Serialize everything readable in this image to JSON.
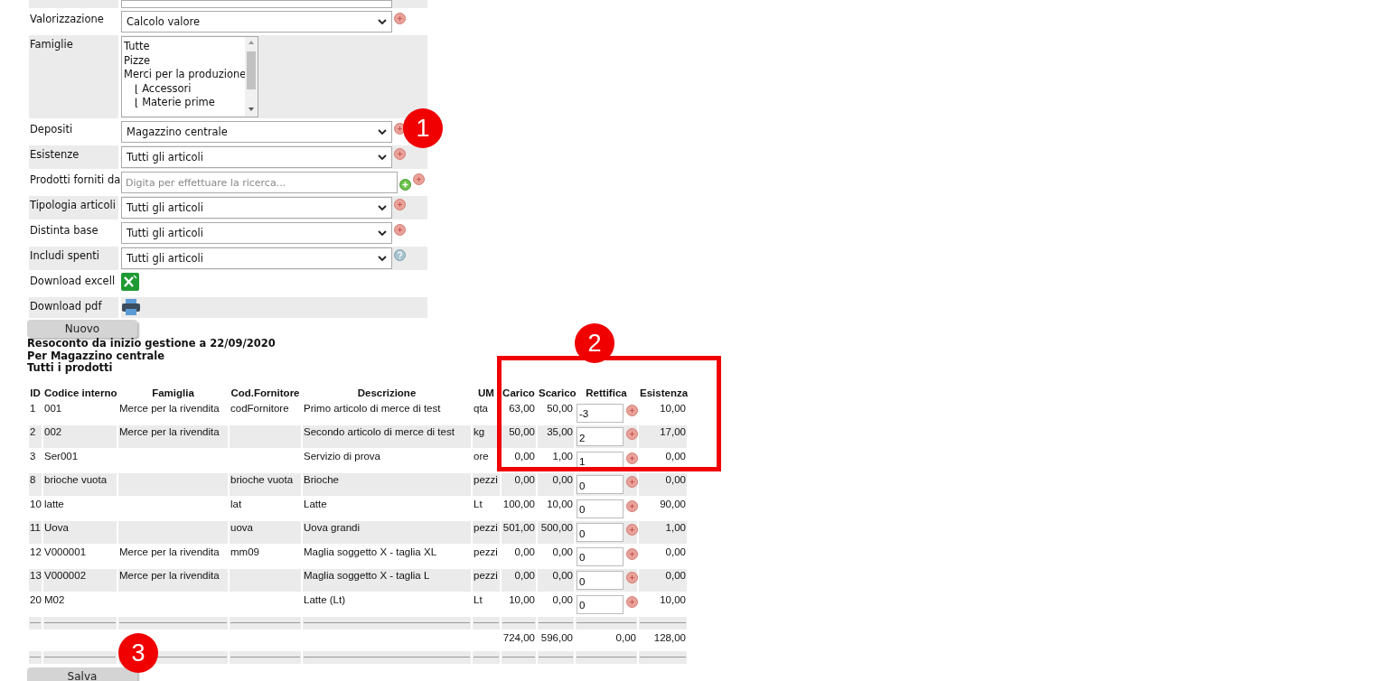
{
  "filters": [
    {
      "kind": "select_cut"
    },
    {
      "kind": "select",
      "label": "Valorizzazione",
      "value": "Calcolo valore"
    },
    {
      "kind": "listbox",
      "label": "Famiglie",
      "items": [
        {
          "text": "Tutte"
        },
        {
          "text": "Pizze"
        },
        {
          "text": "Merci per la produzione",
          "children": [
            {
              "text": "⌊ Accessori"
            },
            {
              "text": "⌊ Materie prime"
            }
          ]
        }
      ]
    },
    {
      "kind": "select",
      "label": "Depositi",
      "value": "Magazzino centrale"
    },
    {
      "kind": "select",
      "label": "Esistenze",
      "value": "Tutti gli articoli"
    },
    {
      "kind": "search",
      "label": "Prodotti forniti da",
      "placeholder": "Digita per effettuare la ricerca..."
    },
    {
      "kind": "select",
      "label": "Tipologia articoli",
      "value": "Tutti gli articoli"
    },
    {
      "kind": "select",
      "label": "Distinta base",
      "value": "Tutti gli articoli"
    },
    {
      "kind": "select_help",
      "label": "Includi spenti",
      "value": "Tutti gli articoli"
    },
    {
      "kind": "excel",
      "label": "Download excell"
    },
    {
      "kind": "pdf",
      "label": "Download pdf"
    }
  ],
  "new_button": "Nuovo",
  "report_lines": [
    "Resoconto da inizio gestione a 22/09/2020",
    "Per Magazzino centrale",
    "Tutti i prodotti"
  ],
  "table": {
    "columns": [
      "ID",
      "Codice interno",
      "Famiglia",
      "Cod.Fornitore",
      "Descrizione",
      "UM",
      "Carico",
      "Scarico",
      "Rettifica",
      "Esistenza"
    ],
    "rows": [
      {
        "id": "1",
        "code": "001",
        "family": "Merce per la rivendita",
        "supplier_code": "codFornitore",
        "description": "Primo articolo di merce di test",
        "um": "qta",
        "carico": "63,00",
        "scarico": "50,00",
        "rettifica": "-3",
        "esistenza": "10,00"
      },
      {
        "id": "2",
        "code": "002",
        "family": "Merce per la rivendita",
        "supplier_code": "",
        "description": "Secondo articolo di merce di test",
        "um": "kg",
        "carico": "50,00",
        "scarico": "35,00",
        "rettifica": "2",
        "esistenza": "17,00"
      },
      {
        "id": "3",
        "code": "Ser001",
        "family": "",
        "supplier_code": "",
        "description": "Servizio di prova",
        "um": "ore",
        "carico": "0,00",
        "scarico": "1,00",
        "rettifica": "1",
        "esistenza": "0,00"
      },
      {
        "id": "8",
        "code": "brioche vuota",
        "family": "",
        "supplier_code": "brioche vuota",
        "description": "Brioche",
        "um": "pezzi",
        "carico": "0,00",
        "scarico": "0,00",
        "rettifica": "0",
        "esistenza": "0,00"
      },
      {
        "id": "10",
        "code": "latte",
        "family": "",
        "supplier_code": "lat",
        "description": "Latte",
        "um": "Lt",
        "carico": "100,00",
        "scarico": "10,00",
        "rettifica": "0",
        "esistenza": "90,00"
      },
      {
        "id": "11",
        "code": "Uova",
        "family": "",
        "supplier_code": "uova",
        "description": "Uova grandi",
        "um": "pezzi",
        "carico": "501,00",
        "scarico": "500,00",
        "rettifica": "0",
        "esistenza": "1,00"
      },
      {
        "id": "12",
        "code": "V000001",
        "family": "Merce per la rivendita",
        "supplier_code": "mm09",
        "description": "Maglia soggetto X - taglia XL",
        "um": "pezzi",
        "carico": "0,00",
        "scarico": "0,00",
        "rettifica": "0",
        "esistenza": "0,00"
      },
      {
        "id": "13",
        "code": "V000002",
        "family": "Merce per la rivendita",
        "supplier_code": "",
        "description": "Maglia soggetto X - taglia L",
        "um": "pezzi",
        "carico": "0,00",
        "scarico": "0,00",
        "rettifica": "0",
        "esistenza": "0,00"
      },
      {
        "id": "20",
        "code": "M02",
        "family": "",
        "supplier_code": "",
        "description": "Latte (Lt)",
        "um": "Lt",
        "carico": "10,00",
        "scarico": "0,00",
        "rettifica": "0",
        "esistenza": "10,00"
      }
    ],
    "totals": {
      "carico": "724,00",
      "scarico": "596,00",
      "rettifica": "0,00",
      "esistenza": "128,00"
    }
  },
  "save_button": "Salva",
  "callouts": [
    "1",
    "2",
    "3"
  ]
}
